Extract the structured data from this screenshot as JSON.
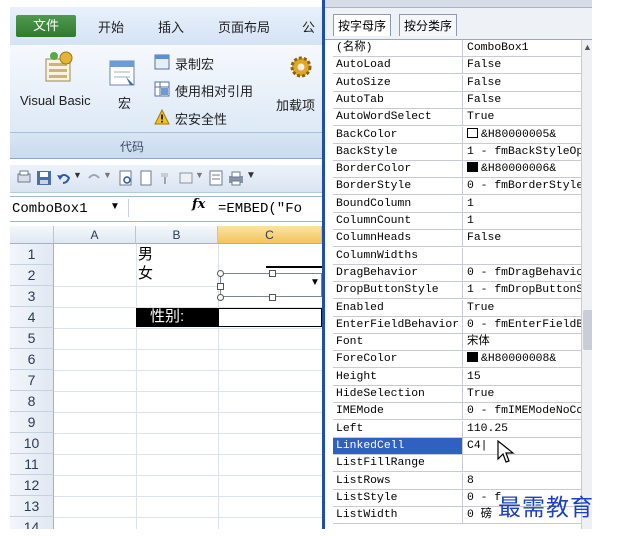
{
  "excel": {
    "ribbon_tabs": [
      "文件",
      "开始",
      "插入",
      "页面布局",
      "公"
    ],
    "ribbon": {
      "visual_basic": "Visual Basic",
      "macros": "宏",
      "record_macro": "录制宏",
      "relative_refs": "使用相对引用",
      "macro_security": "宏安全性",
      "addins": "加载项",
      "group_label": "代码"
    },
    "name_box": "ComboBox1",
    "fx": "fx",
    "formula": "=EMBED(\"Fo",
    "columns": [
      "A",
      "B",
      "C"
    ],
    "selected_column": "C",
    "rows": [
      "1",
      "2",
      "3",
      "4",
      "5",
      "6",
      "7",
      "8",
      "9",
      "10",
      "11",
      "12",
      "13",
      "14"
    ],
    "cells": {
      "b1": "男",
      "b2": "女",
      "b4": "性别:"
    }
  },
  "properties": {
    "tabs": [
      "按字母序",
      "按分类序"
    ],
    "active_tab": "按字母序",
    "rows": [
      {
        "name": "(名称)",
        "value": "ComboBox1"
      },
      {
        "name": "AutoLoad",
        "value": "False"
      },
      {
        "name": "AutoSize",
        "value": "False"
      },
      {
        "name": "AutoTab",
        "value": "False"
      },
      {
        "name": "AutoWordSelect",
        "value": "True"
      },
      {
        "name": "BackColor",
        "value": "&H80000005&",
        "swatch": "#ffffff"
      },
      {
        "name": "BackStyle",
        "value": "1 - fmBackStyleOp"
      },
      {
        "name": "BorderColor",
        "value": "&H80000006&",
        "swatch": "#000000"
      },
      {
        "name": "BorderStyle",
        "value": "0 - fmBorderStyle"
      },
      {
        "name": "BoundColumn",
        "value": "1"
      },
      {
        "name": "ColumnCount",
        "value": "1"
      },
      {
        "name": "ColumnHeads",
        "value": "False"
      },
      {
        "name": "ColumnWidths",
        "value": ""
      },
      {
        "name": "DragBehavior",
        "value": "0 - fmDragBehavio"
      },
      {
        "name": "DropButtonStyle",
        "value": "1 - fmDropButtonS"
      },
      {
        "name": "Enabled",
        "value": "True"
      },
      {
        "name": "EnterFieldBehavior",
        "value": "0 - fmEnterFieldB"
      },
      {
        "name": "Font",
        "value": "宋体"
      },
      {
        "name": "ForeColor",
        "value": "&H80000008&",
        "swatch": "#000000"
      },
      {
        "name": "Height",
        "value": "15"
      },
      {
        "name": "HideSelection",
        "value": "True"
      },
      {
        "name": "IMEMode",
        "value": "0 - fmIMEModeNoCo"
      },
      {
        "name": "Left",
        "value": "110.25"
      },
      {
        "name": "LinkedCell",
        "value": "C4",
        "selected": true
      },
      {
        "name": "ListFillRange",
        "value": ""
      },
      {
        "name": "ListRows",
        "value": "8"
      },
      {
        "name": "ListStyle",
        "value": "0 - f"
      },
      {
        "name": "ListWidth",
        "value": "0 磅"
      }
    ]
  },
  "watermark": "最需教育",
  "colors": {
    "file_tab": "#3a8a3a",
    "selected_property": "#3060c0",
    "panel_border": "#1f4fa8",
    "watermark": "#1a3fbf"
  }
}
